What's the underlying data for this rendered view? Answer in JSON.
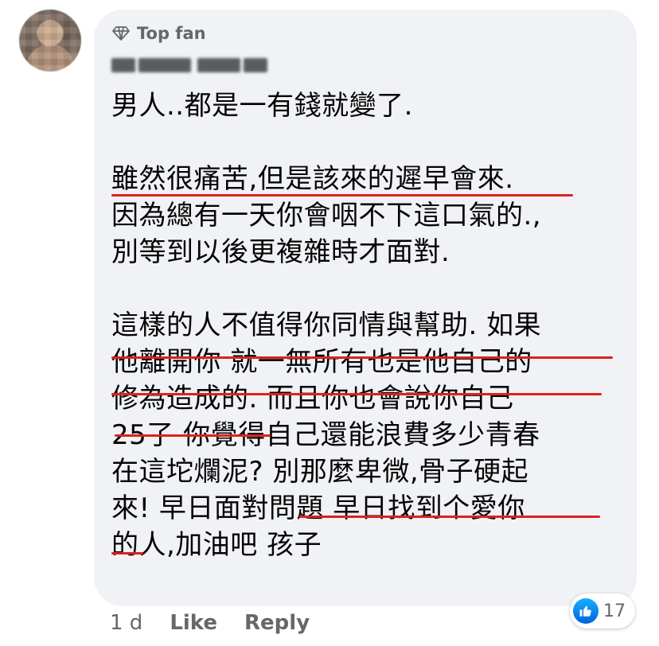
{
  "comment": {
    "badge_label": "Top fan",
    "badge_icon": "diamond-icon",
    "author_name_blurred": true,
    "lines": [
      "男人..都是一有錢就變了.",
      "",
      "雖然很痛苦,但是該來的遲早會來.",
      "因為總有一天你會咽不下這口氣的.,",
      "別等到以後更複雜時才面對.",
      "",
      "這樣的人不值得你同情與幫助. 如果",
      "他離開你 就一無所有也是他自己的",
      "修為造成的. 而且你也會說你自己",
      "25了 你覺得自己還能浪費多少青春",
      "在這坨爛泥? 別那麼卑微,骨子硬起",
      "來! 早日面對問題 早日找到个愛你",
      "的人,加油吧 孩子"
    ]
  },
  "actions": {
    "time": "1 d",
    "like_label": "Like",
    "reply_label": "Reply"
  },
  "reactions": {
    "icon": "like-reaction-icon",
    "count": "17"
  },
  "colors": {
    "bubble": "#f0f2f5",
    "underline": "#e0201d",
    "meta_text": "#65676b",
    "like_blue": "#1877f2"
  }
}
